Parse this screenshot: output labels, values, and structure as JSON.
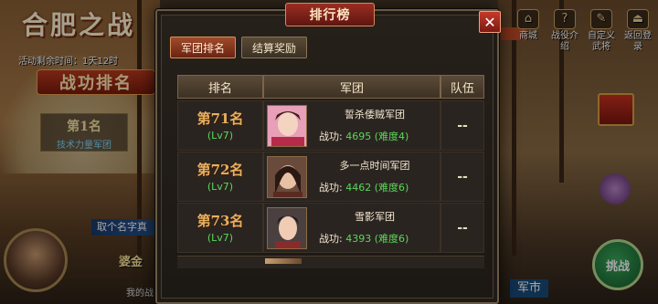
{
  "background": {
    "title": "合肥之战",
    "time_label": "活动剩余时间：1天12时",
    "rank_banner": "战功排名",
    "first_place": {
      "title": "第1名",
      "team": "技术力量军团"
    },
    "name_bar": "取个名字真",
    "bottom_name": "婆金",
    "bottom_sub": "我的战",
    "market": "军市",
    "battle": "挑战",
    "right_icons": [
      {
        "label": "商城",
        "icon": "shop-icon"
      },
      {
        "label": "战役介绍",
        "icon": "info-icon"
      },
      {
        "label": "自定义武将",
        "icon": "edit-icon"
      },
      {
        "label": "返回登录",
        "icon": "home-icon"
      }
    ]
  },
  "modal": {
    "title": "排行榜",
    "close_icon": "close-icon",
    "tabs": [
      {
        "label": "军团排名",
        "active": true
      },
      {
        "label": "结算奖励",
        "active": false
      }
    ],
    "columns": [
      "排名",
      "军团",
      "队伍"
    ],
    "rows": [
      {
        "rank": "第71名",
        "level": "(Lv7)",
        "team": "誓杀倭贼军团",
        "power_label": "战功:",
        "power": "4695",
        "difficulty": "(难度4)",
        "squad": "--"
      },
      {
        "rank": "第72名",
        "level": "(Lv7)",
        "team": "多一点时间军团",
        "power_label": "战功:",
        "power": "4462",
        "difficulty": "(难度6)",
        "squad": "--"
      },
      {
        "rank": "第73名",
        "level": "(Lv7)",
        "team": "雪影军团",
        "power_label": "战功:",
        "power": "4393",
        "difficulty": "(难度6)",
        "squad": "--"
      }
    ]
  }
}
